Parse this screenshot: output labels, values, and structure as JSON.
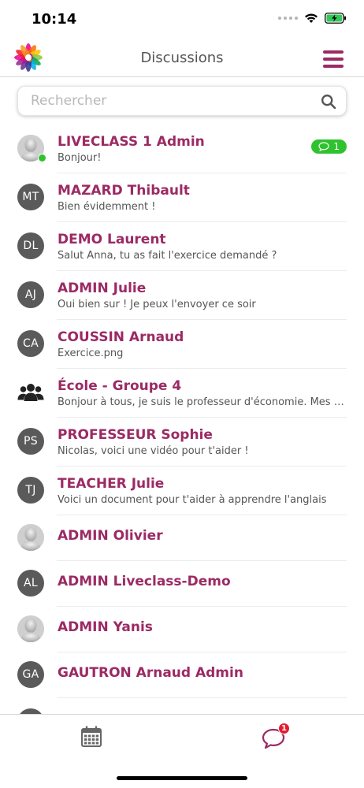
{
  "status": {
    "time": "10:14"
  },
  "header": {
    "title": "Discussions"
  },
  "search": {
    "placeholder": "Rechercher"
  },
  "conversations": [
    {
      "name": "LIVECLASS 1 Admin",
      "preview": "Bonjour!",
      "avatar": "photo",
      "online": true,
      "unread": "1"
    },
    {
      "name": "MAZARD Thibault",
      "preview": "Bien évidemment !",
      "avatar": "MT"
    },
    {
      "name": "DEMO Laurent",
      "preview": "Salut Anna, tu as fait l'exercice demandé ?",
      "avatar": "DL"
    },
    {
      "name": "ADMIN Julie",
      "preview": "Oui bien sur !  Je peux l'envoyer ce soir",
      "avatar": "AJ"
    },
    {
      "name": "COUSSIN Arnaud",
      "preview": "Exercice.png",
      "avatar": "CA"
    },
    {
      "name": "École - Groupe 4",
      "preview": "Bonjour à tous, je suis le professeur d'économie. Mes co...",
      "avatar": "group"
    },
    {
      "name": "PROFESSEUR Sophie",
      "preview": "Nicolas, voici une vidéo pour t'aider !",
      "avatar": "PS"
    },
    {
      "name": "TEACHER Julie",
      "preview": "Voici un document pour t'aider à apprendre l'anglais",
      "avatar": "TJ"
    },
    {
      "name": "ADMIN Olivier",
      "preview": "",
      "avatar": "photo"
    },
    {
      "name": "ADMIN Liveclass-Demo",
      "preview": "",
      "avatar": "AL"
    },
    {
      "name": "ADMIN Yanis",
      "preview": "",
      "avatar": "photo"
    },
    {
      "name": "GAUTRON Arnaud Admin",
      "preview": "",
      "avatar": "GA"
    }
  ],
  "tabbar": {
    "discussions_badge": "1"
  },
  "colors": {
    "accent": "#9b2a64",
    "online": "#2fc22f",
    "badge": "#e31b2e"
  }
}
